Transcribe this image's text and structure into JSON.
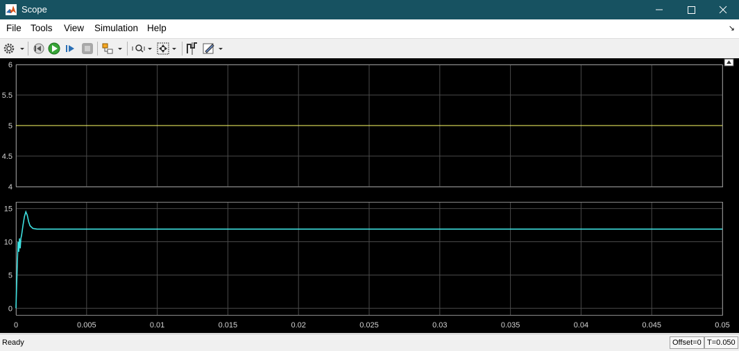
{
  "window": {
    "title": "Scope"
  },
  "menu": [
    "File",
    "Tools",
    "View",
    "Simulation",
    "Help"
  ],
  "toolbar": {
    "icons": [
      "gear-icon",
      "step-back-icon",
      "run-icon",
      "step-forward-icon",
      "stop-icon",
      "highlight-block-icon",
      "zoom-icon",
      "fit-view-icon",
      "cursor-measurements-icon",
      "style-icon"
    ]
  },
  "status": {
    "ready": "Ready",
    "offset": "Offset=0",
    "time": "T=0.050"
  },
  "chart_data": [
    {
      "type": "line",
      "ylim": [
        4,
        6
      ],
      "yticks": [
        "4",
        "4.5",
        "5",
        "5.5",
        "6"
      ],
      "xlim": [
        0,
        0.05
      ],
      "grid": true,
      "series": [
        {
          "color": "#ffff66",
          "x": [
            0,
            0.05
          ],
          "y": [
            5,
            5
          ]
        }
      ]
    },
    {
      "type": "line",
      "ylim": [
        -1,
        16
      ],
      "yticks": [
        "0",
        "5",
        "10",
        "15"
      ],
      "xlim": [
        0,
        0.05
      ],
      "xticks": [
        "0",
        "0.005",
        "0.01",
        "0.015",
        "0.02",
        "0.025",
        "0.03",
        "0.035",
        "0.04",
        "0.045",
        "0.05"
      ],
      "grid": true,
      "series": [
        {
          "color": "#3ee0e0",
          "x": [
            0,
            0.0001,
            0.00015,
            0.0002,
            0.00025,
            0.0003,
            0.00035,
            0.0004,
            0.0005,
            0.0006,
            0.0007,
            0.0008,
            0.0009,
            0.001,
            0.0012,
            0.0015,
            0.002,
            0.005,
            0.05
          ],
          "y": [
            0,
            7,
            10,
            8.5,
            10.5,
            9,
            10.5,
            11,
            12.5,
            13.8,
            14.5,
            14,
            13,
            12.4,
            12,
            11.9,
            11.9,
            11.9,
            11.9
          ]
        }
      ]
    }
  ]
}
